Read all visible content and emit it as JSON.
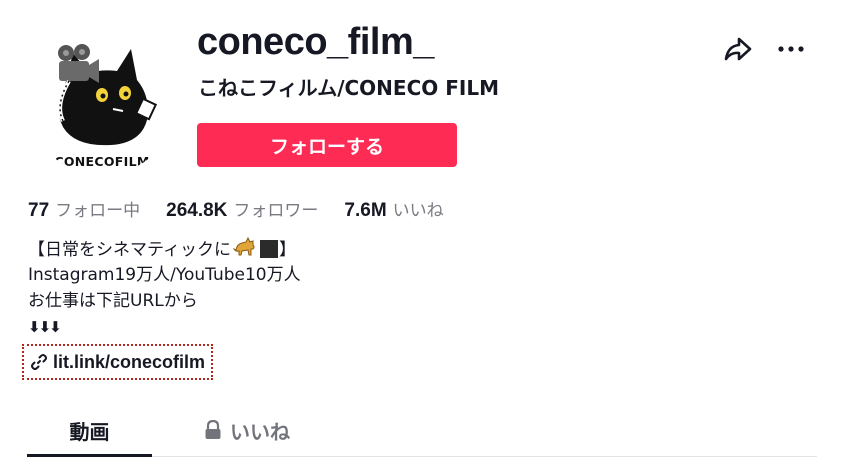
{
  "profile": {
    "username": "coneco_film_",
    "nickname": "こねこフィルム/CONECO FILM",
    "avatar_logo_text": "CONECOFILM",
    "follow_label": "フォローする"
  },
  "actions": {
    "share_icon": "share-arrow-icon",
    "more_icon": "more-dots-icon"
  },
  "stats": {
    "following": {
      "value": "77",
      "label": "フォロー中"
    },
    "followers": {
      "value": "264.8K",
      "label": "フォロワー"
    },
    "likes": {
      "value": "7.6M",
      "label": "いいね"
    }
  },
  "bio": {
    "line1_prefix": "【日常をシネマティックに",
    "line1_suffix": "】",
    "line2": "Instagram19万人/YouTube10万人",
    "line3": "お仕事は下記URLから",
    "line4": "⬇⬇⬇"
  },
  "link": {
    "text": "lit.link/conecofilm",
    "icon": "link-chain-icon"
  },
  "tabs": [
    {
      "label": "動画",
      "active": true
    },
    {
      "label": "いいね",
      "locked": true
    }
  ],
  "colors": {
    "follow_button": "#fe2c55",
    "text_primary": "#161823",
    "text_secondary": "#7a7b82"
  }
}
